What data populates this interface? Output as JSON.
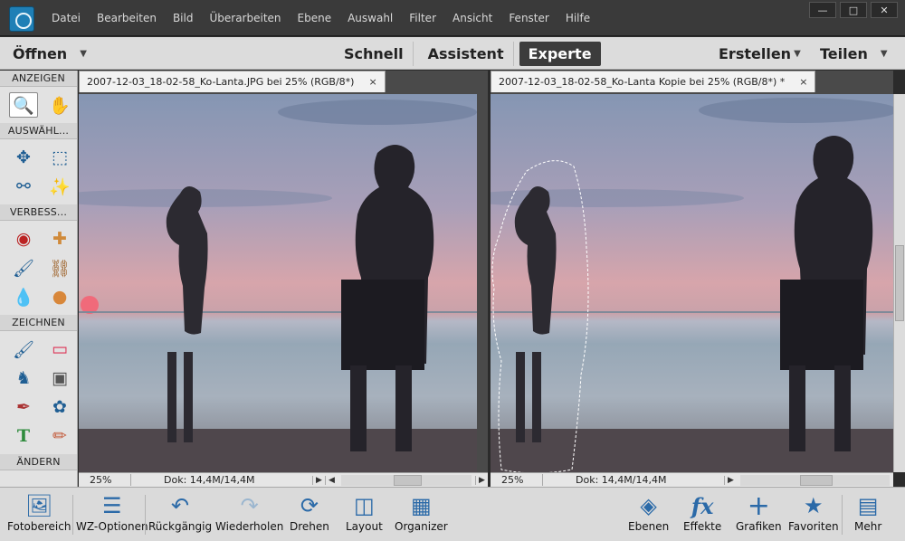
{
  "menu": [
    "Datei",
    "Bearbeiten",
    "Bild",
    "Überarbeiten",
    "Ebene",
    "Auswahl",
    "Filter",
    "Ansicht",
    "Fenster",
    "Hilfe"
  ],
  "modebar": {
    "open_label": "Öffnen",
    "modes": [
      "Schnell",
      "Assistent",
      "Experte"
    ],
    "active_mode": "Experte",
    "create_label": "Erstellen",
    "share_label": "Teilen"
  },
  "tools": {
    "sections": [
      {
        "title": "ANZEIGEN",
        "tools": [
          "zoom-icon",
          "hand-icon"
        ]
      },
      {
        "title": "AUSWÄHL...",
        "tools": [
          "move-icon",
          "marquee-icon",
          "lasso-icon",
          "magic-wand-icon"
        ]
      },
      {
        "title": "VERBESS...",
        "tools": [
          "red-eye-icon",
          "healing-brush-icon",
          "smart-brush-icon",
          "clone-stamp-icon",
          "blur-icon",
          "sponge-icon"
        ]
      },
      {
        "title": "ZEICHNEN",
        "tools": [
          "brush-icon",
          "eraser-icon",
          "paint-bucket-icon",
          "gradient-icon",
          "eyedropper-icon",
          "custom-shape-icon",
          "text-icon",
          "pencil-icon"
        ]
      },
      {
        "title": "ÄNDERN",
        "tools": []
      }
    ]
  },
  "documents": [
    {
      "tab": "2007-12-03_18-02-58_Ko-Lanta.JPG bei 25% (RGB/8*)",
      "close": "×",
      "zoom": "25%",
      "dok": "Dok: 14,4M/14,4M"
    },
    {
      "tab": "2007-12-03_18-02-58_Ko-Lanta Kopie bei 25% (RGB/8*) *",
      "close": "×",
      "zoom": "25%",
      "dok": "Dok: 14,4M/14,4M"
    }
  ],
  "bottombar": {
    "left": [
      {
        "name": "photo-bin",
        "label": "Fotobereich",
        "icon": "photo-bin-icon"
      },
      {
        "name": "tool-options",
        "label": "WZ-Optionen",
        "icon": "tool-options-icon"
      },
      {
        "name": "undo",
        "label": "Rückgängig",
        "icon": "undo-icon"
      },
      {
        "name": "redo",
        "label": "Wiederholen",
        "icon": "redo-icon"
      },
      {
        "name": "rotate",
        "label": "Drehen",
        "icon": "rotate-icon"
      },
      {
        "name": "layout",
        "label": "Layout",
        "icon": "layout-icon"
      },
      {
        "name": "organizer",
        "label": "Organizer",
        "icon": "organizer-icon"
      }
    ],
    "right": [
      {
        "name": "layers",
        "label": "Ebenen",
        "icon": "layers-icon"
      },
      {
        "name": "effects",
        "label": "Effekte",
        "icon": "fx-icon"
      },
      {
        "name": "graphics",
        "label": "Grafiken",
        "icon": "plus-icon"
      },
      {
        "name": "favorites",
        "label": "Favoriten",
        "icon": "star-icon"
      },
      {
        "name": "more",
        "label": "Mehr",
        "icon": "more-icon"
      }
    ]
  },
  "colors": {
    "accent": "#2b6aa8",
    "active_mode_bg": "#3c3c3c",
    "panel_bg": "#e2e2e2"
  }
}
